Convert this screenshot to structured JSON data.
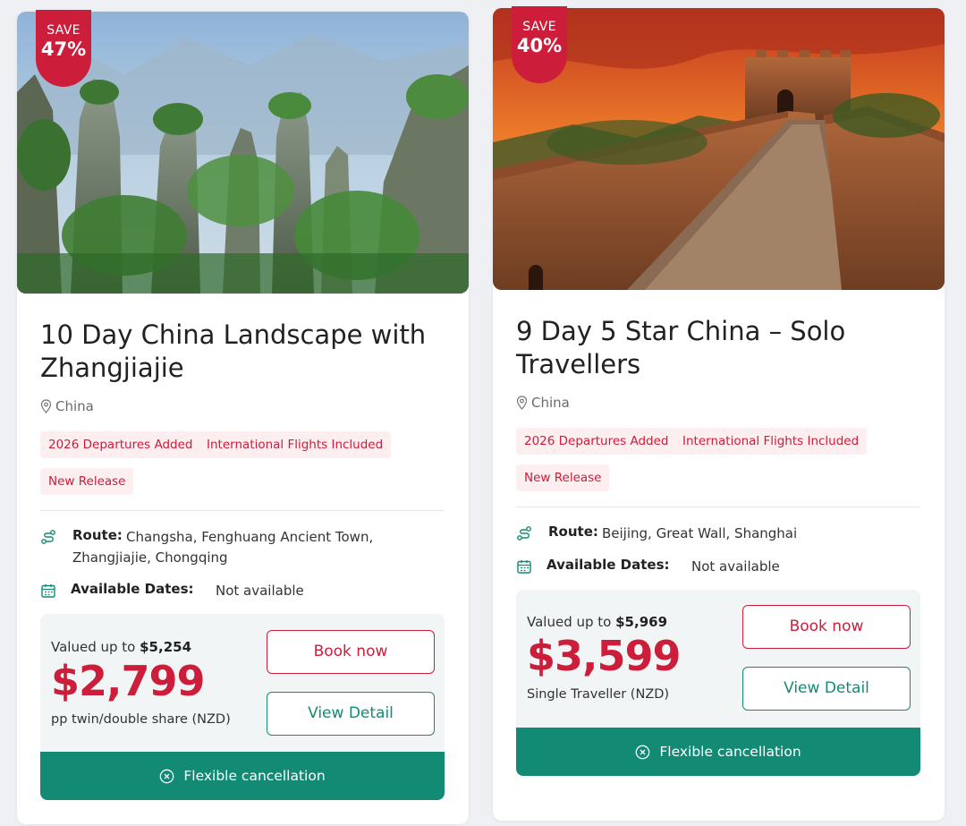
{
  "cards": [
    {
      "badge": {
        "save": "SAVE",
        "percent": "47%"
      },
      "title": "10 Day China Landscape with Zhangjiajie",
      "location": "China",
      "tags": [
        "2026 Departures Added",
        "International Flights Included",
        "New Release"
      ],
      "route_label": "Route:",
      "route": "Changsha, Fenghuang Ancient Town, Zhangjiajie, Chongqing",
      "dates_label": "Available Dates:",
      "dates": "Not available",
      "valued_prefix": "Valued up to",
      "valued_amount": "$5,254",
      "price": "$2,799",
      "price_note": "pp twin/double share (NZD)",
      "book_label": "Book now",
      "detail_label": "View Detail",
      "flex_label": "Flexible cancellation"
    },
    {
      "badge": {
        "save": "SAVE",
        "percent": "40%"
      },
      "title": "9 Day 5 Star China – Solo Travellers",
      "location": "China",
      "tags": [
        "2026 Departures Added",
        "International Flights Included",
        "New Release"
      ],
      "route_label": "Route:",
      "route": "Beijing, Great Wall, Shanghai",
      "dates_label": "Available Dates:",
      "dates": "Not available",
      "valued_prefix": "Valued up to",
      "valued_amount": "$5,969",
      "price": "$3,599",
      "price_note": "Single Traveller (NZD)",
      "book_label": "Book now",
      "detail_label": "View Detail",
      "flex_label": "Flexible cancellation"
    }
  ],
  "icons": {
    "location": "map-pin-icon",
    "route": "route-icon",
    "dates": "calendar-icon",
    "flex": "x-circle-icon"
  },
  "colors": {
    "brand_red": "#cc1d3a",
    "brand_green": "#138a74",
    "tag_bg": "#fdeef0",
    "price_box_bg": "#f1f5f6"
  }
}
